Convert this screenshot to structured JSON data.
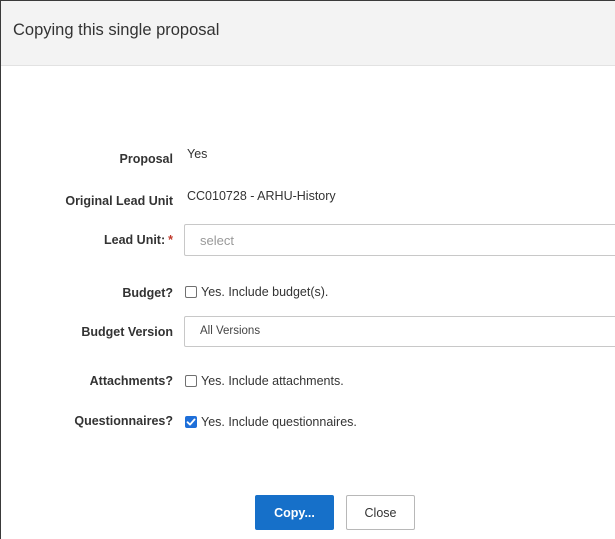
{
  "dialog": {
    "title": "Copying this single proposal"
  },
  "form": {
    "proposal": {
      "label": "Proposal",
      "value": "Yes"
    },
    "original_lead_unit": {
      "label": "Original Lead Unit",
      "value": "CC010728 - ARHU-History"
    },
    "lead_unit": {
      "label": "Lead Unit:",
      "required_marker": "*",
      "placeholder": "select"
    },
    "budget": {
      "label": "Budget?",
      "checkbox_label": "Yes. Include budget(s).",
      "checked": false
    },
    "budget_version": {
      "label": "Budget Version",
      "selected": "All Versions"
    },
    "attachments": {
      "label": "Attachments?",
      "checkbox_label": "Yes. Include attachments.",
      "checked": false
    },
    "questionnaires": {
      "label": "Questionnaires?",
      "checkbox_label": "Yes. Include questionnaires.",
      "checked": true
    }
  },
  "buttons": {
    "copy_label": "Copy...",
    "close_label": "Close"
  },
  "colors": {
    "primary": "#1670c9",
    "checkbox_checked": "#1e6fd9",
    "required": "#c0392b"
  }
}
